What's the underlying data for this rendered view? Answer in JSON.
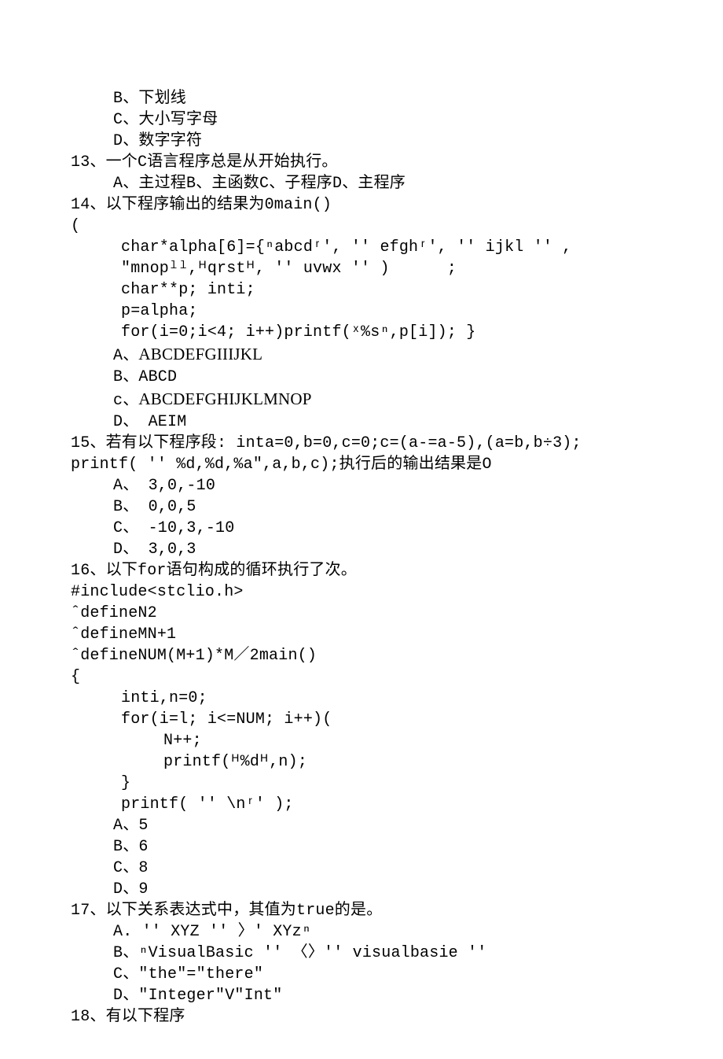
{
  "lines": [
    {
      "cls": "i1",
      "text": "B、下划线"
    },
    {
      "cls": "i1",
      "text": "C、大小写字母"
    },
    {
      "cls": "i1",
      "text": "D、数字字符"
    },
    {
      "cls": "",
      "text": "13、一个C语言程序总是从开始执行。"
    },
    {
      "cls": "i1",
      "text": "A、主过程B、主函数C、子程序D、主程序"
    },
    {
      "cls": "",
      "text": "14、以下程序输出的结果为0main()"
    },
    {
      "cls": "",
      "text": "("
    },
    {
      "cls": "i2",
      "text": "char*alpha[6]={ⁿabcdʳ', '' efghʳ', '' ijkl '' ,″mnopˡˡ,ᴴqrstᴴ, '' uvwx '' )      ;"
    },
    {
      "cls": "i2",
      "text": "char**p; inti;"
    },
    {
      "cls": "i2",
      "text": "p=alpha;"
    },
    {
      "cls": "i2",
      "text": "for(i=0;i<4; i++)printf(ˣ%sⁿ,p[i]); }"
    },
    {
      "cls": "i1",
      "text": "A、",
      "roman": "ABCDEFGIIIJKL"
    },
    {
      "cls": "i1",
      "text": "B、ABCD"
    },
    {
      "cls": "i1",
      "text": "c、",
      "roman": "ABCDEFGHIJKLMNOP"
    },
    {
      "cls": "i1",
      "text": "D、 AEIM"
    },
    {
      "cls": "",
      "text": "15、若有以下程序段: inta=0,b=0,c=0;c=(a-=a-5),(a=b,b÷3);"
    },
    {
      "cls": "",
      "text": "printf( '' %d,%d,%a″,a,b,c);执行后的输出结果是O"
    },
    {
      "cls": "i1",
      "text": "A、 3,0,-10"
    },
    {
      "cls": "i1",
      "text": "B、 0,0,5"
    },
    {
      "cls": "i1",
      "text": "C、 -10,3,-10"
    },
    {
      "cls": "i1",
      "text": "D、 3,0,3"
    },
    {
      "cls": "",
      "text": "16、以下for语句构成的循环执行了次。"
    },
    {
      "cls": "",
      "text": "#include<stclio.h>"
    },
    {
      "cls": "",
      "text": "ˆdefineN2"
    },
    {
      "cls": "",
      "text": "ˆdefineMN+1"
    },
    {
      "cls": "",
      "text": "ˆdefineNUM(M+1)*M／2main()"
    },
    {
      "cls": "",
      "text": "{"
    },
    {
      "cls": "i2",
      "text": "inti,n=0;"
    },
    {
      "cls": "i2",
      "text": "for(i=l; i<=NUM; i++)("
    },
    {
      "cls": "i3",
      "text": "N++;"
    },
    {
      "cls": "i3",
      "text": "printf(ᴴ%dᴴ,n);"
    },
    {
      "cls": "i2",
      "text": "}"
    },
    {
      "cls": "i2",
      "text": "printf( '' \\nʳ' );"
    },
    {
      "cls": "i1",
      "text": "A、5"
    },
    {
      "cls": "i1",
      "text": "B、6"
    },
    {
      "cls": "i1",
      "text": "C、8"
    },
    {
      "cls": "i1",
      "text": "D、9"
    },
    {
      "cls": "",
      "text": "17、以下关系表达式中，其值为true的是。"
    },
    {
      "cls": "i1",
      "text": "A. '' XYZ '' 〉' XYzⁿ"
    },
    {
      "cls": "i1",
      "text": "B、ⁿVisualBasic '' 〈〉'' visualbasie '' "
    },
    {
      "cls": "i1",
      "text": "C、″the″=″there″"
    },
    {
      "cls": "i1",
      "text": "D、″Integer″V″Int″"
    },
    {
      "cls": "",
      "text": "18、有以下程序"
    }
  ]
}
